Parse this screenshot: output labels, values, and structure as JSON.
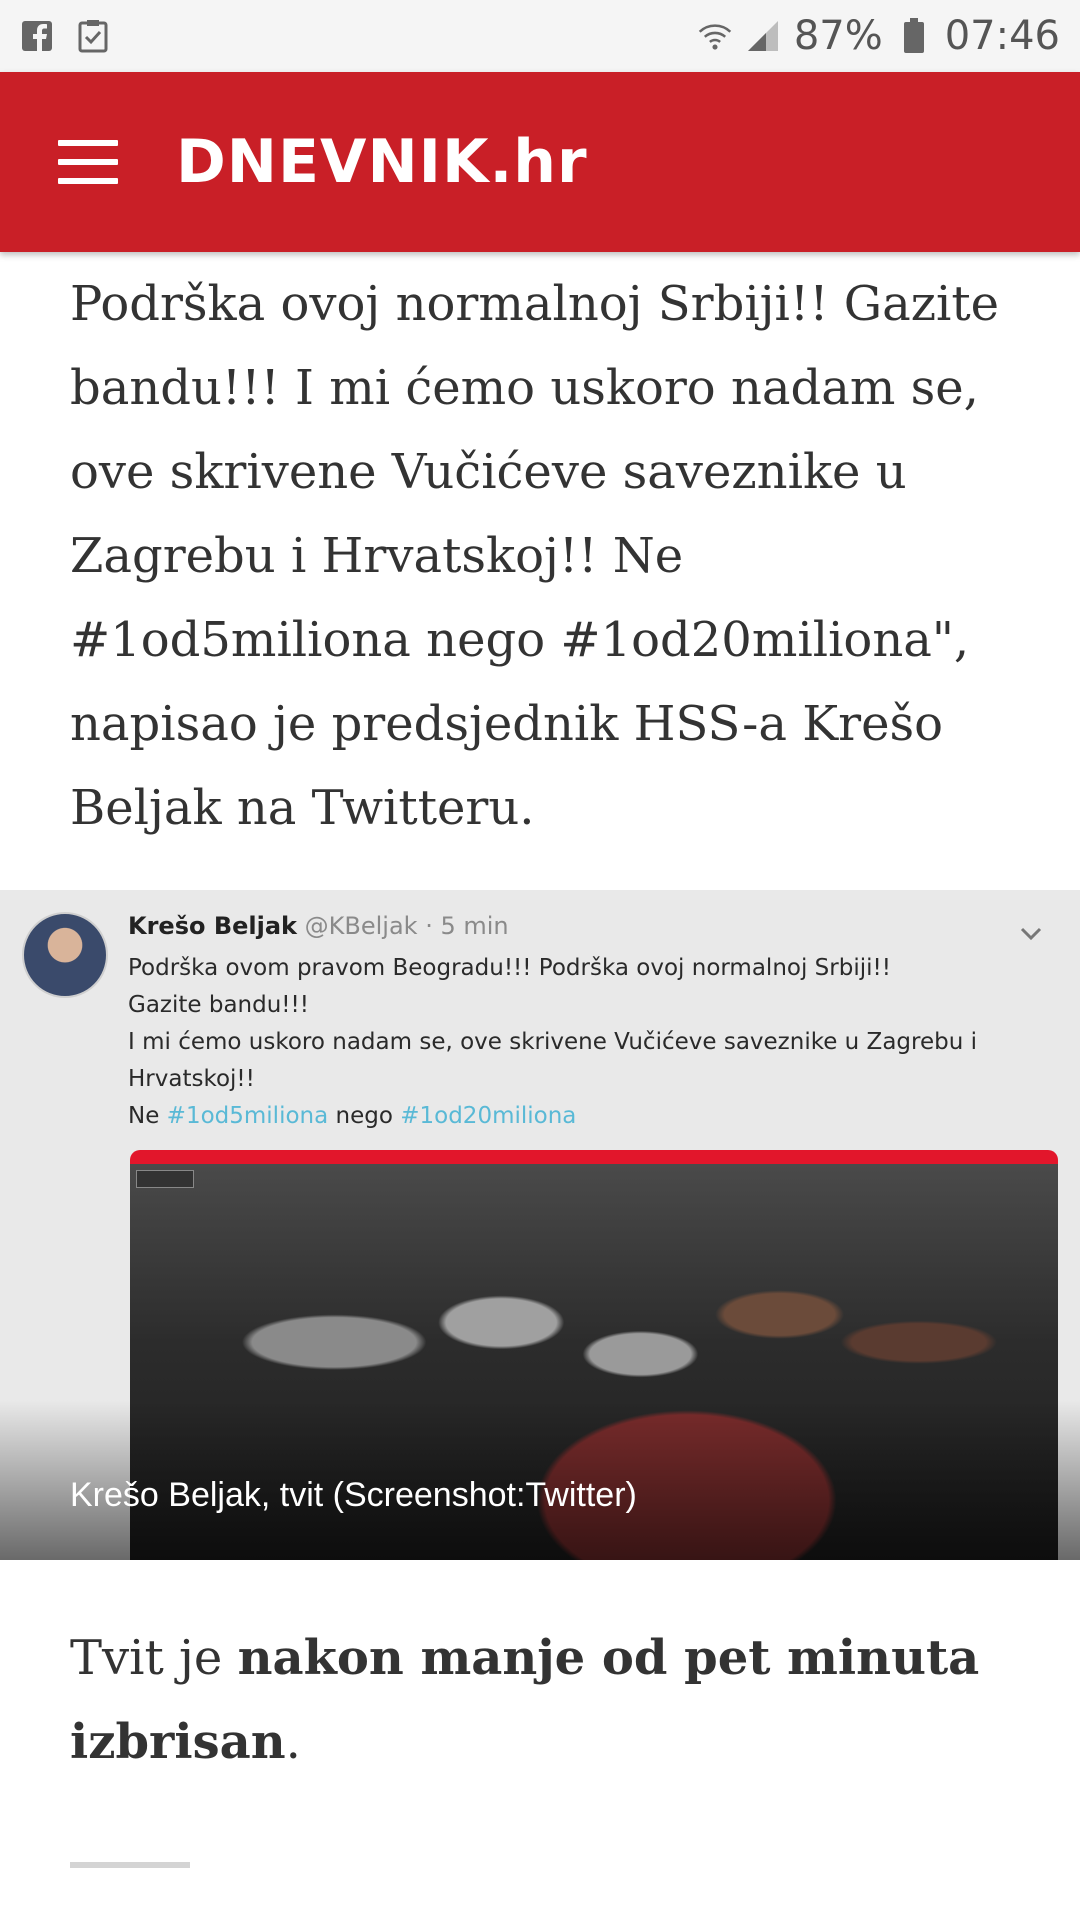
{
  "status_bar": {
    "battery": "87%",
    "time": "07:46",
    "icons": [
      "facebook-icon",
      "checklist-icon",
      "wifi-icon",
      "signal-icon",
      "battery-icon"
    ]
  },
  "header": {
    "brand": "DNEVNIK.hr",
    "menu_icon": "hamburger-icon",
    "background_color": "#c91f27"
  },
  "article": {
    "paragraph1": "Podrška ovoj normalnoj Srbiji!! Gazite bandu!!! I mi ćemo uskoro nadam se, ove skrivene Vučićeve saveznike u Zagrebu i Hrvatskoj!! Ne #1od5miliona nego #1od20miliona\", napisao je predsjednik HSS-a Krešo Beljak na Twitteru.",
    "paragraph2_start": "Tvit je ",
    "paragraph2_bold": "nakon manje od pet minuta izbrisan",
    "paragraph2_end": "."
  },
  "figure": {
    "tweet": {
      "name": "Krešo Beljak",
      "handle": "@KBeljak · 5 min",
      "lines": [
        "Podrška ovom pravom Beogradu!!! Podrška ovoj normalnoj Srbiji!!",
        "Gazite bandu!!!",
        "I mi ćemo uskoro nadam se, ove skrivene Vučićeve saveznike u Zagrebu i",
        "Hrvatskoj!!"
      ],
      "last_line_prefix": "Ne ",
      "hashtag1": "#1od5miliona",
      "last_line_mid": " nego ",
      "hashtag2": "#1od20miliona"
    },
    "caption": "Krešo Beljak, tvit (Screenshot:Twitter)"
  }
}
